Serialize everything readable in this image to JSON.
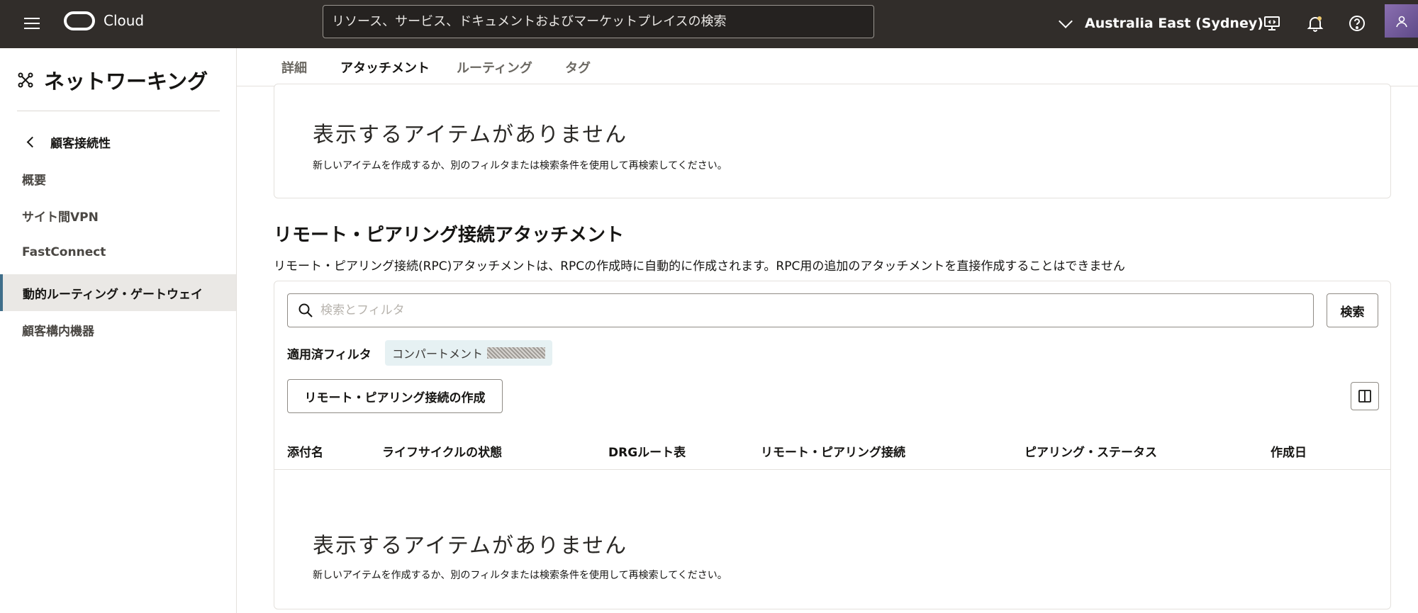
{
  "topbar": {
    "brand": "Cloud",
    "search_placeholder": "リソース、サービス、ドキュメントおよびマーケットプレイスの検索",
    "region": "Australia East (Sydney)"
  },
  "sidebar": {
    "title": "ネットワーキング",
    "back_label": "顧客接続性",
    "items": [
      {
        "label": "概要"
      },
      {
        "label": "サイト間VPN"
      },
      {
        "label": "FastConnect"
      },
      {
        "label": "動的ルーティング・ゲートウェイ",
        "active": true
      },
      {
        "label": "顧客構内機器"
      }
    ]
  },
  "tabs": [
    {
      "label": "詳細"
    },
    {
      "label": "アタッチメント",
      "active": true
    },
    {
      "label": "ルーティング"
    },
    {
      "label": "タグ"
    }
  ],
  "top_panel": {
    "empty_title": "表示するアイテムがありません",
    "empty_desc": "新しいアイテムを作成するか、別のフィルタまたは検索条件を使用して再検索してください。"
  },
  "rpc_section": {
    "title": "リモート・ピアリング接続アタッチメント",
    "description": "リモート・ピアリング接続(RPC)アタッチメントは、RPCの作成時に自動的に作成されます。RPC用の追加のアタッチメントを直接作成することはできません",
    "filter_placeholder": "検索とフィルタ",
    "search_button": "検索",
    "applied_filters_label": "適用済フィルタ",
    "filter_chip": "コンパートメント",
    "create_button": "リモート・ピアリング接続の作成",
    "columns": [
      "添付名",
      "ライフサイクルの状態",
      "DRGルート表",
      "リモート・ピアリング接続",
      "ピアリング・ステータス",
      "作成日"
    ],
    "empty_title": "表示するアイテムがありません",
    "empty_desc": "新しいアイテムを作成するか、別のフィルタまたは検索条件を使用して再検索してください。"
  },
  "colors": {
    "topbar_bg": "#312d2a",
    "active_nav_bg": "#eae8e5",
    "chip_bg": "#e6f1f3"
  }
}
